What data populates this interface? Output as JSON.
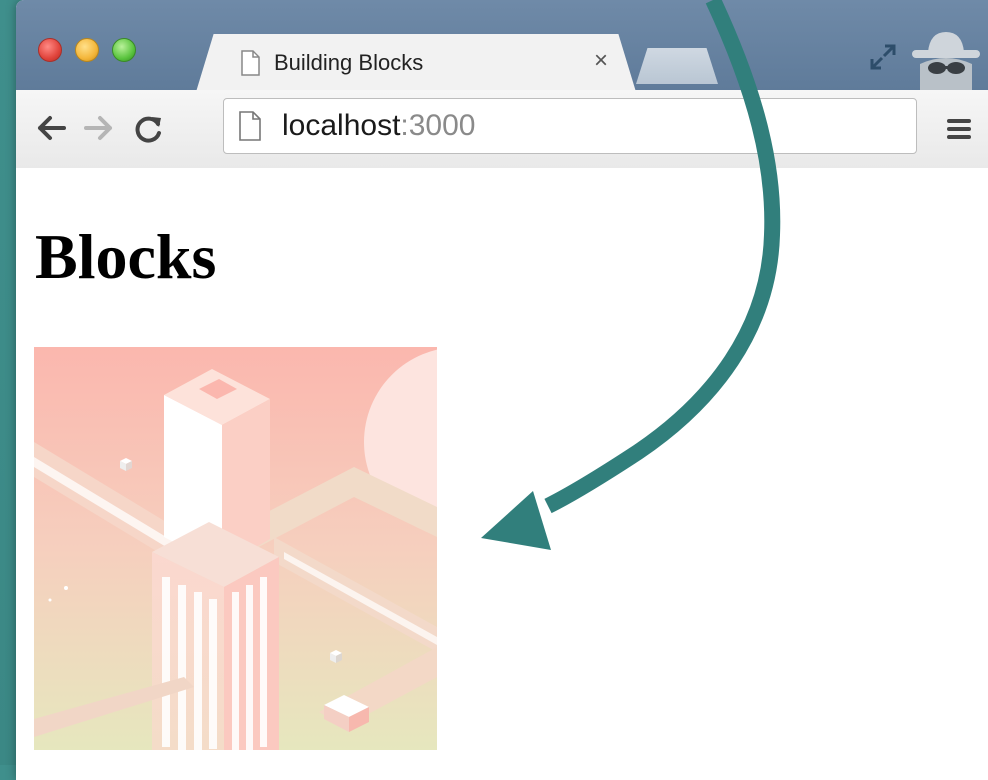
{
  "browser": {
    "tab": {
      "title": "Building Blocks",
      "close_glyph": "×"
    },
    "address_bar": {
      "host": "localhost",
      "port": ":3000"
    },
    "icons": [
      "back-arrow-icon",
      "forward-arrow-icon",
      "reload-icon",
      "page-icon",
      "menu-icon",
      "incognito-icon",
      "fullscreen-icon"
    ]
  },
  "page": {
    "heading": "Blocks",
    "image": {
      "subject": "isometric building blocks illustration"
    }
  },
  "colors": {
    "background": "#3a8683",
    "arrow": "#317f7c",
    "titlebar": "#6b87a5",
    "illustration_top": "#fbb9b0",
    "illustration_bottom": "#e7e6bd"
  }
}
